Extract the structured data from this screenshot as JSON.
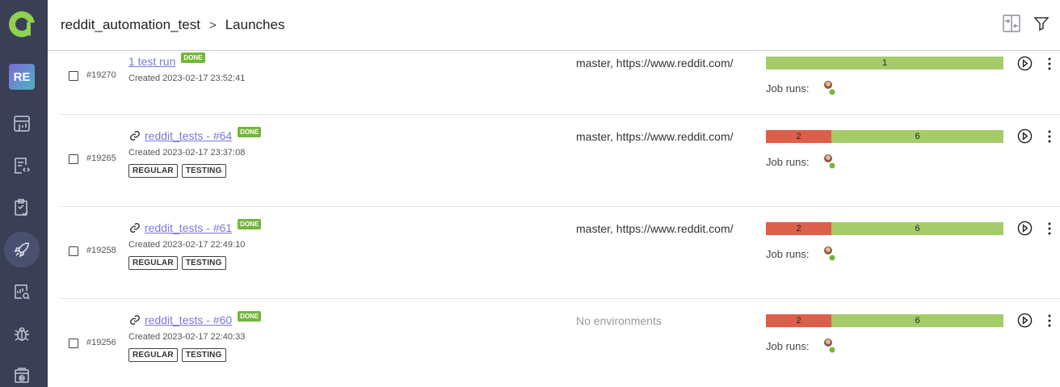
{
  "header": {
    "project": "reddit_automation_test",
    "separator": ">",
    "page": "Launches"
  },
  "sidebar": {
    "project_badge": "RE",
    "items": [
      {
        "icon": "dashboard-icon"
      },
      {
        "icon": "test-cases-icon"
      },
      {
        "icon": "test-plans-icon"
      },
      {
        "icon": "launches-icon",
        "active": true
      },
      {
        "icon": "analytics-icon"
      },
      {
        "icon": "defects-icon"
      },
      {
        "icon": "jobs-icon"
      }
    ]
  },
  "launches": [
    {
      "id": "#19270",
      "name": "1 test run",
      "status": "DONE",
      "created": "Created 2023-02-17 23:52:41",
      "tags": [],
      "environment": "master, https://www.reddit.com/",
      "failed": null,
      "passed": 1,
      "job_runs_label": "Job runs:"
    },
    {
      "id": "#19265",
      "name": "reddit_tests - #64",
      "status": "DONE",
      "created": "Created 2023-02-17 23:37:08",
      "tags": [
        "REGULAR",
        "TESTING"
      ],
      "environment": "master, https://www.reddit.com/",
      "failed": 2,
      "passed": 6,
      "job_runs_label": "Job runs:"
    },
    {
      "id": "#19258",
      "name": "reddit_tests - #61",
      "status": "DONE",
      "created": "Created 2023-02-17 22:49:10",
      "tags": [
        "REGULAR",
        "TESTING"
      ],
      "environment": "master, https://www.reddit.com/",
      "failed": 2,
      "passed": 6,
      "job_runs_label": "Job runs:"
    },
    {
      "id": "#19256",
      "name": "reddit_tests - #60",
      "status": "DONE",
      "created": "Created 2023-02-17 22:40:33",
      "tags": [
        "REGULAR",
        "TESTING"
      ],
      "environment": "No environments",
      "failed": 2,
      "passed": 6,
      "job_runs_label": "Job runs:"
    }
  ],
  "colors": {
    "sidebar_bg": "#3a3f55",
    "failed": "#dc5f4b",
    "passed": "#a6cc6a",
    "done_badge": "#74b739",
    "link": "#7b78d6",
    "logo": "#8fd14f"
  }
}
